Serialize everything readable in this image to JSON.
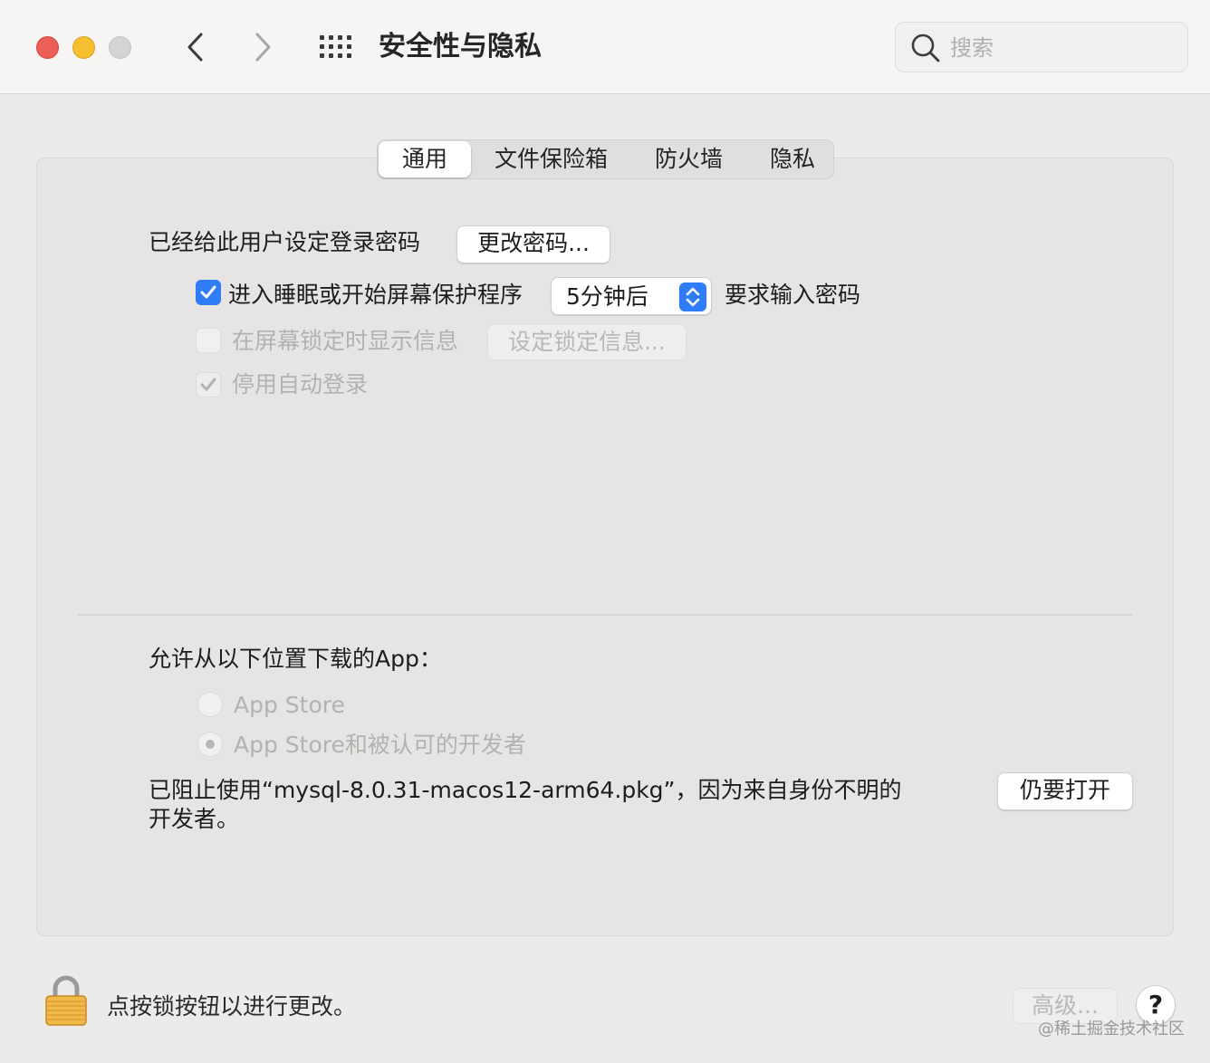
{
  "window": {
    "title": "安全性与隐私",
    "search_placeholder": "搜索",
    "back_icon": "chevron-left-icon",
    "forward_icon": "chevron-right-icon",
    "grid_icon": "show-all-grid-icon"
  },
  "tabs": [
    {
      "label": "通用",
      "active": true
    },
    {
      "label": "文件保险箱",
      "active": false
    },
    {
      "label": "防火墙",
      "active": false
    },
    {
      "label": "隐私",
      "active": false
    }
  ],
  "general": {
    "password_set_text": "已经给此用户设定登录密码",
    "change_password_button": "更改密码...",
    "require_password_checkbox": {
      "label": "进入睡眠或开始屏幕保护程序",
      "checked": true
    },
    "require_password_delay": "5分钟后",
    "require_password_suffix": "要求输入密码",
    "show_message_checkbox": {
      "label": "在屏幕锁定时显示信息",
      "checked": false,
      "enabled": false
    },
    "set_lock_message_button": "设定锁定信息...",
    "disable_auto_login_checkbox": {
      "label": "停用自动登录",
      "checked": true,
      "enabled": false
    }
  },
  "downloads": {
    "heading": "允许从以下位置下载的App：",
    "options": [
      {
        "label": "App Store",
        "selected": false,
        "enabled": false
      },
      {
        "label": "App Store和被认可的开发者",
        "selected": true,
        "enabled": false
      }
    ],
    "blocked_line1": "已阻止使用“mysql-8.0.31-macos12-arm64.pkg”，因为来自身份不明的",
    "blocked_line2": "开发者。",
    "open_anyway_button": "仍要打开"
  },
  "footer": {
    "lock_text": "点按锁按钮以进行更改。",
    "advanced_button": "高级...",
    "help_button": "?",
    "watermark": "@稀土掘金技术社区"
  },
  "colors": {
    "accent": "#2f7cf6",
    "close": "#ec5f57",
    "minimize": "#f5bf2f"
  }
}
